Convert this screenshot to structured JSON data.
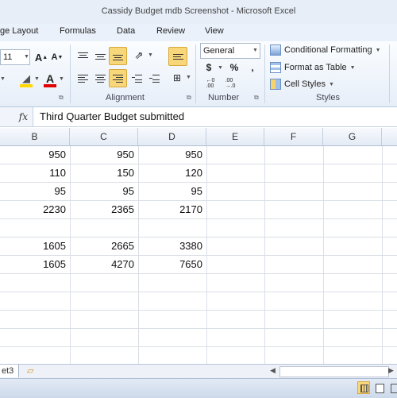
{
  "window": {
    "title": "Cassidy Budget mdb Screenshot - Microsoft Excel"
  },
  "ribbon_tabs": [
    "ge Layout",
    "Formulas",
    "Data",
    "Review",
    "View"
  ],
  "ribbon": {
    "font_size": "11",
    "number_format": "General",
    "groups": {
      "alignment": "Alignment",
      "number": "Number",
      "styles": "Styles"
    },
    "styles_items": {
      "conditional": "Conditional Formatting",
      "format_table": "Format as Table",
      "cell_styles": "Cell Styles"
    },
    "number_symbols": {
      "currency": "$",
      "percent": "%",
      "comma": ","
    },
    "font_buttons": {
      "grow": "A",
      "shrink": "A",
      "font_color": "A"
    }
  },
  "formula_bar": {
    "fx": "fx",
    "content": "Third Quarter Budget submitted"
  },
  "columns": [
    "B",
    "C",
    "D",
    "E",
    "F",
    "G"
  ],
  "rows": [
    [
      "950",
      "950",
      "950"
    ],
    [
      "110",
      "150",
      "120"
    ],
    [
      "95",
      "95",
      "95"
    ],
    [
      "2230",
      "2365",
      "2170"
    ],
    [
      "",
      "",
      ""
    ],
    [
      "1605",
      "2665",
      "3380"
    ],
    [
      "1605",
      "4270",
      "7650"
    ]
  ],
  "sheet_tab": "et3",
  "colors": {
    "accent": "#f8d77a",
    "ribbon_bg": "#e6eef8",
    "header_bg": "#e4ebf5"
  }
}
